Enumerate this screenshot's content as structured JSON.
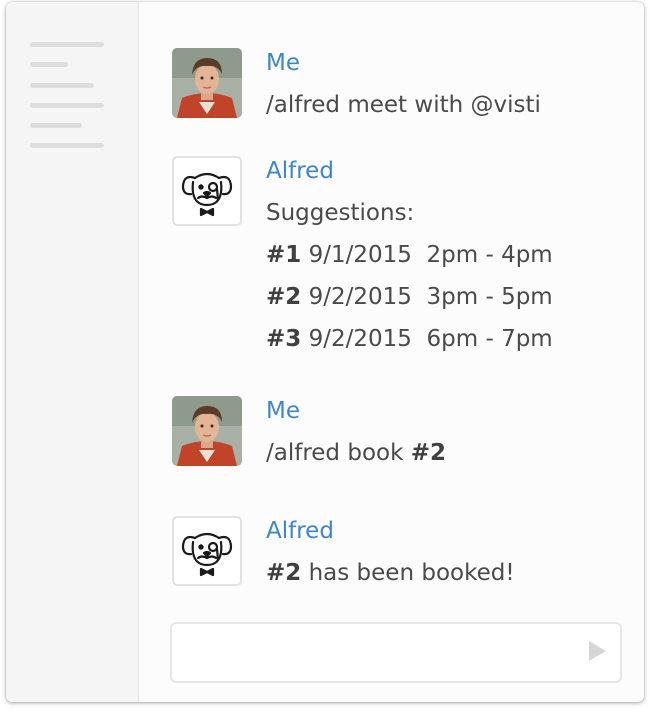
{
  "messages": [
    {
      "author": "Me",
      "avatar": "user-photo",
      "text": "/alfred meet with @visti"
    },
    {
      "author": "Alfred",
      "avatar": "butler-dog-icon",
      "text": "Suggestions:",
      "suggestions": [
        {
          "number": "#1",
          "detail": " 9/1/2015  2pm - 4pm"
        },
        {
          "number": "#2",
          "detail": " 9/2/2015  3pm - 5pm"
        },
        {
          "number": "#3",
          "detail": " 9/2/2015  6pm - 7pm"
        }
      ]
    },
    {
      "author": "Me",
      "avatar": "user-photo",
      "text": "/alfred book ",
      "bold": "#2"
    },
    {
      "author": "Alfred",
      "avatar": "butler-dog-icon",
      "bold": "#2",
      "text": " has been booked!"
    }
  ],
  "composer": {
    "value": "",
    "send_icon": "send-icon"
  },
  "colors": {
    "author": "#3f85cc",
    "text": "#4a4a4a",
    "sidebar": "#f5f5f5"
  }
}
